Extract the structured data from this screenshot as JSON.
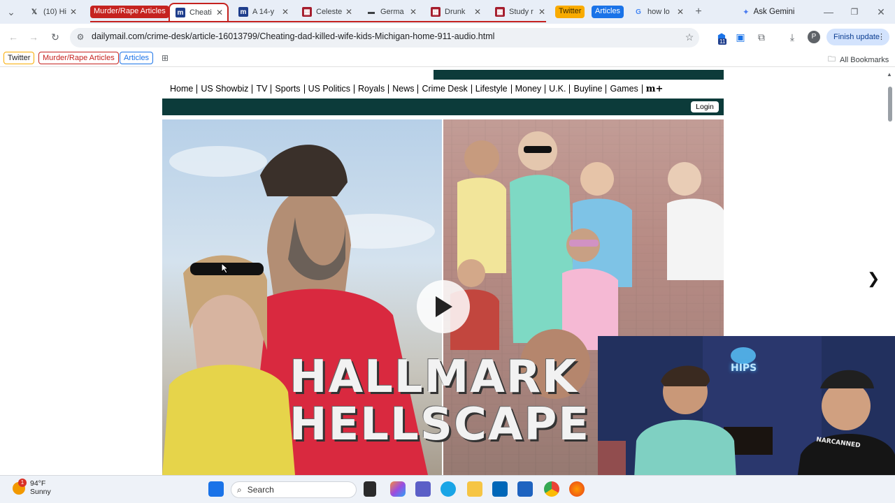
{
  "tabs": [
    {
      "label": "(10) Hi",
      "favicon": "x-icon"
    },
    {
      "label": "Cheati",
      "favicon": "m-icon",
      "active": true
    },
    {
      "label": "A 14-y",
      "favicon": "m-icon"
    },
    {
      "label": "Celeste",
      "favicon": "book-icon"
    },
    {
      "label": "Germa",
      "favicon": "bar-icon"
    },
    {
      "label": "Drunk",
      "favicon": "book-icon"
    },
    {
      "label": "Study r",
      "favicon": "book-icon"
    },
    {
      "label": "how lo",
      "favicon": "google-icon"
    }
  ],
  "tab_groups": {
    "murder": "Murder/Rape Articles",
    "twitter": "Twitter",
    "articles": "Articles"
  },
  "ask_gemini": "Ask Gemini",
  "address": {
    "url": "dailymail.com/crime-desk/article-16013799/Cheating-dad-killed-wife-kids-Michigan-home-911-audio.html",
    "finish_update": "Finish update",
    "extension_badge": "11",
    "profile_initial": "P"
  },
  "bookmarks": {
    "items": [
      "Twitter",
      "Murder/Rape Articles",
      "Articles"
    ],
    "all": "All Bookmarks"
  },
  "site_nav": {
    "items": [
      "Home",
      "US Showbiz",
      "TV",
      "Sports",
      "US Politics",
      "Royals",
      "News",
      "Crime Desk",
      "Lifestyle",
      "Money",
      "U.K.",
      "Buyline",
      "Games"
    ],
    "plus_logo": "m+",
    "login": "Login"
  },
  "video": {
    "headline_line1": "HALLMARK",
    "headline_line2": "HELLSCAPE"
  },
  "webcam": {
    "sign": "HIPS",
    "shirt_text": "NARCANNED"
  },
  "taskbar": {
    "weather_temp": "94°F",
    "weather_desc": "Sunny",
    "weather_badge": "1",
    "search_label": "Search"
  },
  "colors": {
    "group_red": "#c5221f",
    "group_orange": "#f9ab00",
    "group_blue": "#1a73e8",
    "nav_green": "#0c3b3a"
  }
}
